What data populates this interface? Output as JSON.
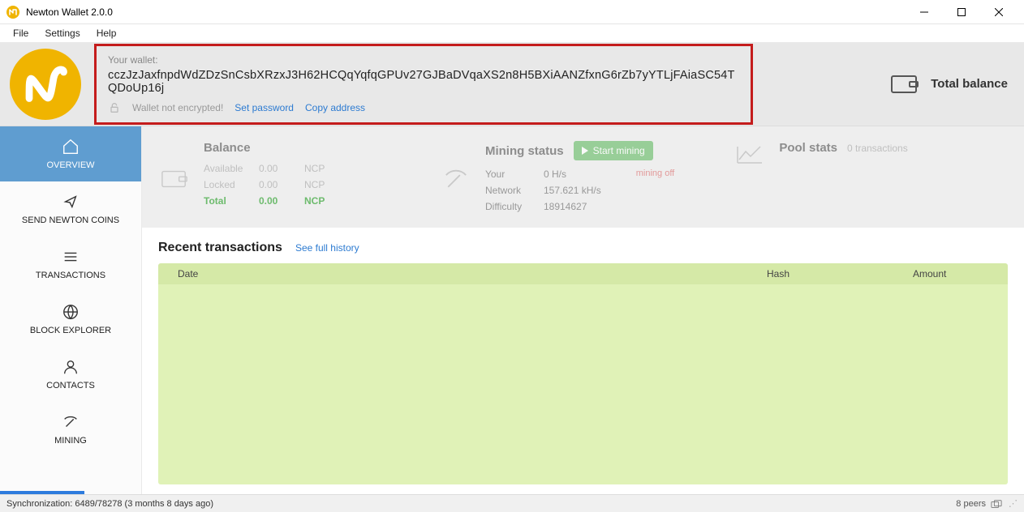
{
  "titlebar": {
    "title": "Newton Wallet 2.0.0"
  },
  "menu": {
    "file": "File",
    "settings": "Settings",
    "help": "Help"
  },
  "header": {
    "your_wallet_label": "Your wallet:",
    "address": "cczJzJaxfnpdWdZDzSnCsbXRzxJ3H62HCQqYqfqGPUv27GJBaDVqaXS2n8H5BXiAANZfxnG6rZb7yYTLjFAiaSC54TQDoUp16j",
    "not_encrypted": "Wallet not encrypted!",
    "set_password": "Set password",
    "copy_address": "Copy address",
    "total_balance": "Total balance"
  },
  "sidebar": {
    "items": [
      {
        "label": "OVERVIEW"
      },
      {
        "label": "SEND NEWTON COINS"
      },
      {
        "label": "TRANSACTIONS"
      },
      {
        "label": "BLOCK EXPLORER"
      },
      {
        "label": "CONTACTS"
      },
      {
        "label": "MINING"
      }
    ]
  },
  "balance": {
    "title": "Balance",
    "available_label": "Available",
    "available_value": "0.00",
    "locked_label": "Locked",
    "locked_value": "0.00",
    "total_label": "Total",
    "total_value": "0.00",
    "unit": "NCP"
  },
  "mining": {
    "title": "Mining status",
    "start_label": "Start mining",
    "your_label": "Your",
    "your_value": "0 H/s",
    "off_label": "mining off",
    "network_label": "Network",
    "network_value": "157.621 kH/s",
    "difficulty_label": "Difficulty",
    "difficulty_value": "18914627"
  },
  "pool": {
    "title": "Pool stats",
    "sub": "0 transactions"
  },
  "tx": {
    "title": "Recent transactions",
    "see_full": "See full history",
    "col_date": "Date",
    "col_hash": "Hash",
    "col_amount": "Amount"
  },
  "status": {
    "sync": "Synchronization: 6489/78278 (3 months 8 days ago)",
    "peers": "8 peers"
  }
}
